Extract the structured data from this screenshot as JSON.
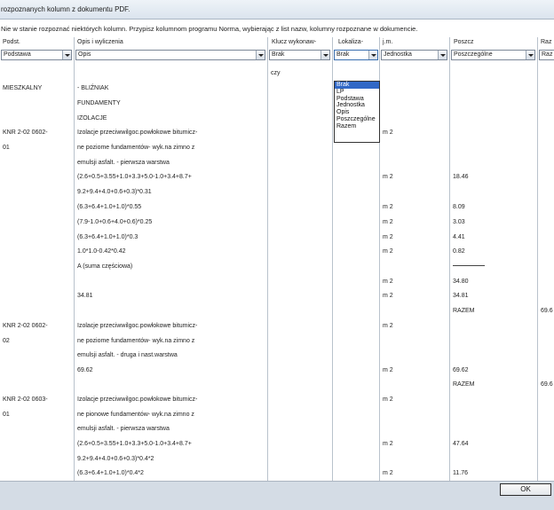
{
  "window": {
    "title": "rozpoznanych kolumn z dokumentu PDF."
  },
  "hint": "Nie w stanie rozpoznać niektórych kolumn. Przypisz kolumnom programu Norma, wybierając z list nazw, kolumny rozpoznane w dokumencie.",
  "columns": [
    {
      "header": "Podst.",
      "selected": "Podstawa"
    },
    {
      "header": "Opis i wyliczenia",
      "selected": "Opis"
    },
    {
      "header": "Klucz wykonaw-",
      "selected": "Brak"
    },
    {
      "header": "Lokaliza-",
      "selected": "Brak"
    },
    {
      "header": "j.m.",
      "selected": "Jednostka"
    },
    {
      "header": "Poszcz",
      "selected": "Poszczególne"
    },
    {
      "header": "Raz",
      "selected": "Raz"
    }
  ],
  "dropdown": {
    "options": [
      "Brak",
      "LP",
      "Podstawa",
      "Jednostka",
      "Opis",
      "Poszczególne",
      "Razem"
    ],
    "highlighted": "Brak"
  },
  "cells": {
    "c_czy": "czy",
    "p_mieszkalny": "MIESZKALNY",
    "o_blizniak": "- BLIŹNIAK",
    "o_fundamenty": "FUNDAMENTY",
    "o_izolacje": "IZOLACJE",
    "p_knr1a": "KNR 2-02 0602-",
    "p_knr1b": "01",
    "o_iz1a": "Izolacje przeciwwilgoc.powłokowe bitumicz-",
    "o_iz1b": "ne poziome fundamentów- wyk.na zimno z",
    "o_iz1c": "emulsji asfalt. - pierwsza warstwa",
    "o_calc1": "(2.6+0.5+3.55+1.0+3.3+5.0-1.0+3.4+8.7+",
    "o_calc2": "9.2+9.4+4.0+0.6+0.3)*0.31",
    "o_calc3": "(6.3+6.4+1.0+1.0)*0.55",
    "o_calc4": "(7.9-1.0+0.6+4.0+0.6)*0.25",
    "o_calc5": "(6.3+6.4+1.0+1.0)*0.3",
    "o_calc6": "1.0*1.0-0.42*0.42",
    "o_suma": "A (suma częściowa)",
    "o_3481": "34.81",
    "p_knr2a": "KNR 2-02 0602-",
    "p_knr2b": "02",
    "o_iz2a": "Izolacje przeciwwilgoc.powłokowe bitumicz-",
    "o_iz2b": "ne poziome fundamentów- wyk.na zimno z",
    "o_iz2c": "emulsji asfalt. - druga i nast.warstwa",
    "o_6962": "69.62",
    "p_knr3a": "KNR 2-02 0603-",
    "p_knr3b": "01",
    "o_iz3a": "Izolacje przeciwwilgoc.powłokowe bitumicz-",
    "o_iz3b": "ne pionowe fundamentów- wyk.na zimno z",
    "o_iz3c": "emulsji asfalt. - pierwsza warstwa",
    "o_calc7": "(2.6+0.5+3.55+1.0+3.3+5.0-1.0+3.4+8.7+",
    "o_calc8": "9.2+9.4+4.0+0.6+0.3)*0.4*2",
    "o_calc9": "(6.3+6.4+1.0+1.0)*0.4*2",
    "jm": "m 2",
    "v_1846": "18.46",
    "v_809": "8.09",
    "v_303": "3.03",
    "v_441": "4.41",
    "v_082": "0.82",
    "v_3480": "34.80",
    "v_3481": "34.81",
    "v_razem": "RAZEM",
    "v_6962": "69.62",
    "v_4764": "47.64",
    "v_1176": "11.76",
    "r_696a": "69.6",
    "r_696b": "69.6"
  },
  "footer": {
    "ok_label": "OK"
  }
}
